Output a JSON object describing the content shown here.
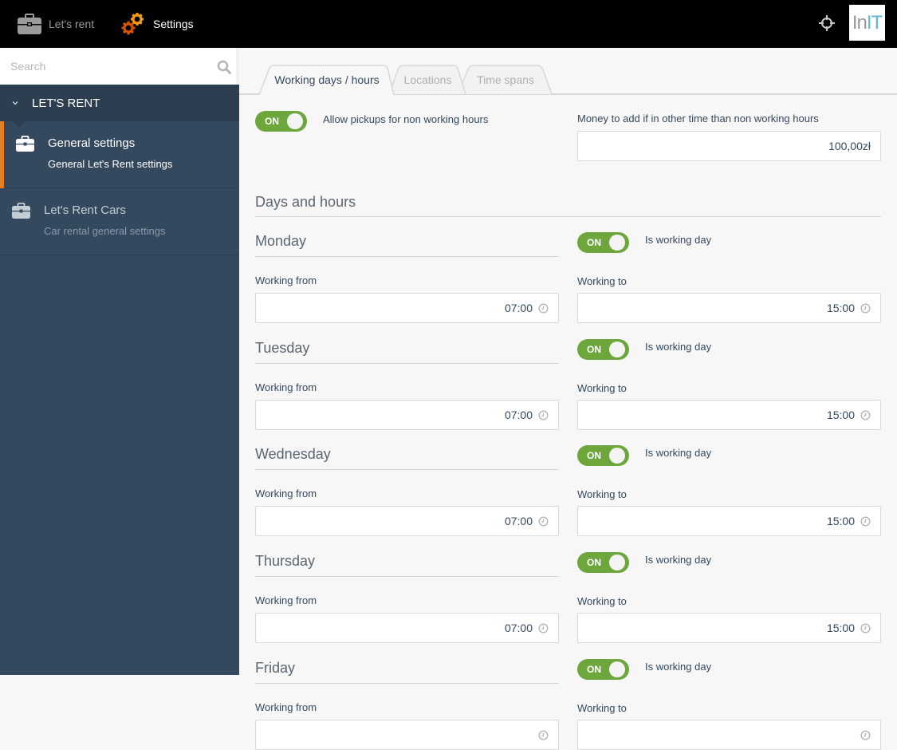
{
  "topbar": {
    "app_label": "Let's rent",
    "settings_label": "Settings",
    "logo_part1": "In",
    "logo_part2": "IT",
    "colors": {
      "gear_small": "#f39c12",
      "gear_large": "#d35400"
    }
  },
  "sidebar": {
    "search_placeholder": "Search",
    "group_title": "LET'S RENT",
    "items": [
      {
        "title": "General settings",
        "subtitle": "General Let's Rent settings",
        "icon": "briefcase-icon",
        "active": true
      },
      {
        "title": "Let's Rent Cars",
        "subtitle": "Car rental general settings",
        "icon": "briefcase-icon",
        "active": false
      }
    ],
    "active_accent": "#e67e22"
  },
  "tabs": [
    {
      "label": "Working days / hours",
      "active": true
    },
    {
      "label": "Locations",
      "active": false
    },
    {
      "label": "Time spans",
      "active": false
    }
  ],
  "general": {
    "allow_pickups_toggle": "ON",
    "allow_pickups_label": "Allow pickups for non working hours",
    "money_label": "Money to add if in other time than non working hours",
    "money_value": "100,00zł"
  },
  "days_section_title": "Days and hours",
  "labels": {
    "is_working_day": "Is working day",
    "working_from": "Working from",
    "working_to": "Working to",
    "toggle_on": "ON"
  },
  "days": [
    {
      "name": "Monday",
      "working": "ON",
      "from": "07:00",
      "to": "15:00"
    },
    {
      "name": "Tuesday",
      "working": "ON",
      "from": "07:00",
      "to": "15:00"
    },
    {
      "name": "Wednesday",
      "working": "ON",
      "from": "07:00",
      "to": "15:00"
    },
    {
      "name": "Thursday",
      "working": "ON",
      "from": "07:00",
      "to": "15:00"
    },
    {
      "name": "Friday",
      "working": "ON"
    }
  ],
  "toggle_color": "#6da73b"
}
